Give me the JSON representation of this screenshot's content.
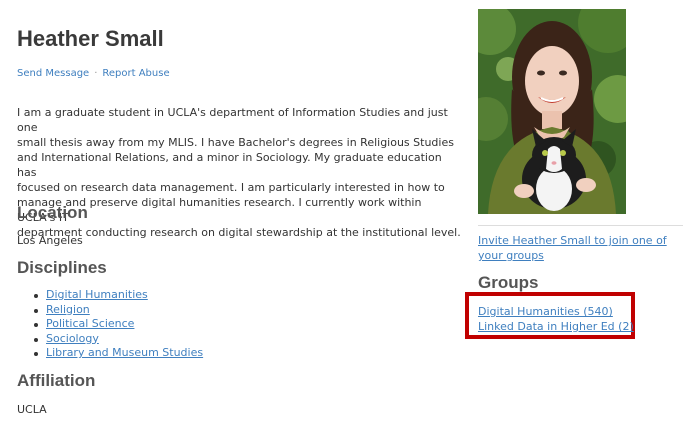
{
  "profile": {
    "name": "Heather Small",
    "actions": {
      "send_message": "Send Message",
      "separator": "·",
      "report_abuse": "Report Abuse"
    },
    "bio": "I am a graduate student in UCLA's department of Information Studies and just one\nsmall thesis away from my MLIS.   I have Bachelor's degrees in Religious Studies\nand International Relations, and a minor in Sociology. My graduate education has\nfocused on research data management. I am particularly interested in how to\nmanage and preserve digital humanities research. I currently work within UCLA's IT\ndepartment conducting research on digital stewardship at the institutional level."
  },
  "location": {
    "heading": "Location",
    "value": "Los Angeles"
  },
  "disciplines": {
    "heading": "Disciplines",
    "items": [
      "Digital Humanities",
      "Religion",
      "Political Science",
      "Sociology",
      "Library and Museum Studies"
    ]
  },
  "affiliation": {
    "heading": "Affiliation",
    "value": "UCLA"
  },
  "sidebar": {
    "invite_link": "Invite Heather Small to join one of your groups",
    "groups_heading": "Groups",
    "groups": [
      "Digital Humanities (540)",
      "Linked Data in Higher Ed (2)"
    ]
  },
  "colors": {
    "link": "#3f7fbf",
    "heading": "#555555",
    "highlight_border": "#c00000"
  }
}
